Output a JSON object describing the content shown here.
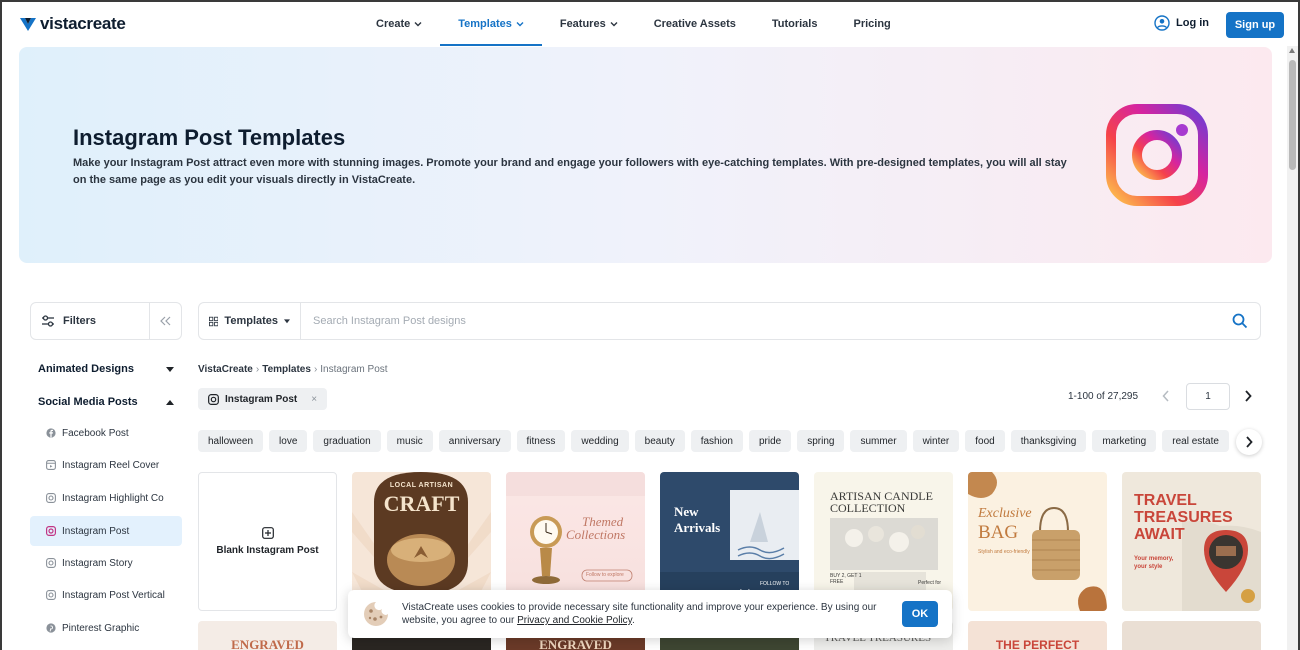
{
  "header": {
    "logo_text": "vistacreate",
    "nav": [
      {
        "label": "Create",
        "has_dropdown": true
      },
      {
        "label": "Templates",
        "has_dropdown": true,
        "active": true
      },
      {
        "label": "Features",
        "has_dropdown": true
      },
      {
        "label": "Creative Assets"
      },
      {
        "label": "Tutorials"
      },
      {
        "label": "Pricing"
      }
    ],
    "login_label": "Log in",
    "signup_label": "Sign up"
  },
  "hero": {
    "title": "Instagram Post Templates",
    "description": "Make your Instagram Post attract even more with stunning images. Promote your brand and engage your followers with eye-catching templates. With pre-designed templates, you will all stay on the same page as you edit your visuals directly in VistaCreate."
  },
  "filters": {
    "label": "Filters"
  },
  "search": {
    "category_label": "Templates",
    "placeholder": "Search Instagram Post designs"
  },
  "sidebar": {
    "sections": [
      {
        "label": "Animated Designs",
        "expanded": false
      },
      {
        "label": "Social Media Posts",
        "expanded": true
      }
    ],
    "items": [
      {
        "label": "Facebook Post",
        "icon": "facebook-icon"
      },
      {
        "label": "Instagram Reel Cover",
        "icon": "reel-icon"
      },
      {
        "label": "Instagram Highlight Co",
        "icon": "instagram-icon"
      },
      {
        "label": "Instagram Post",
        "icon": "instagram-icon",
        "active": true
      },
      {
        "label": "Instagram Story",
        "icon": "instagram-icon"
      },
      {
        "label": "Instagram Post Vertical",
        "icon": "instagram-icon"
      },
      {
        "label": "Pinterest Graphic",
        "icon": "pinterest-icon"
      }
    ]
  },
  "breadcrumb": {
    "items": [
      "VistaCreate",
      "Templates",
      "Instagram Post"
    ]
  },
  "active_filter": {
    "label": "Instagram Post",
    "remove": "×"
  },
  "pagination": {
    "count_text": "1-100 of 27,295",
    "page": "1"
  },
  "tags": [
    "halloween",
    "love",
    "graduation",
    "music",
    "anniversary",
    "fitness",
    "wedding",
    "beauty",
    "fashion",
    "pride",
    "spring",
    "summer",
    "winter",
    "food",
    "thanksgiving",
    "marketing",
    "real estate"
  ],
  "blank_card": {
    "label": "Blank Instagram Post"
  },
  "templates": [
    {
      "line1": "LOCAL ARTISAN",
      "line2": "CRAFT"
    },
    {
      "line1": "Themed",
      "line2": "Collections",
      "line3": "Follow to explore"
    },
    {
      "line1": "New",
      "line2": "Arrivals",
      "line3": "FOLLOW TO"
    },
    {
      "line1": "ARTISAN CANDLE",
      "line2": "COLLECTION",
      "line3": "BUY 2, GET 1 FREE",
      "line4": "Perfect for"
    },
    {
      "line1": "Exclusive",
      "line2": "BAG",
      "line3": "Stylish and eco-friendly"
    },
    {
      "line1": "TRAVEL",
      "line2": "TREASURES",
      "line3": "AWAIT",
      "line4": "Your memory, your style"
    }
  ],
  "row2_templates": [
    "ENGRAVED",
    "ENGRAVED",
    "TRAVEL TREASURES",
    "THE PERFECT"
  ],
  "cookie": {
    "text": "VistaCreate uses cookies to provide necessary site functionality and improve your experience. By using our website, you agree to our ",
    "link": "Privacy and Cookie Policy",
    "end": ".",
    "ok_label": "OK"
  },
  "colors": {
    "brand_blue": "#1573c6",
    "text_dark": "#0e1d2f"
  }
}
